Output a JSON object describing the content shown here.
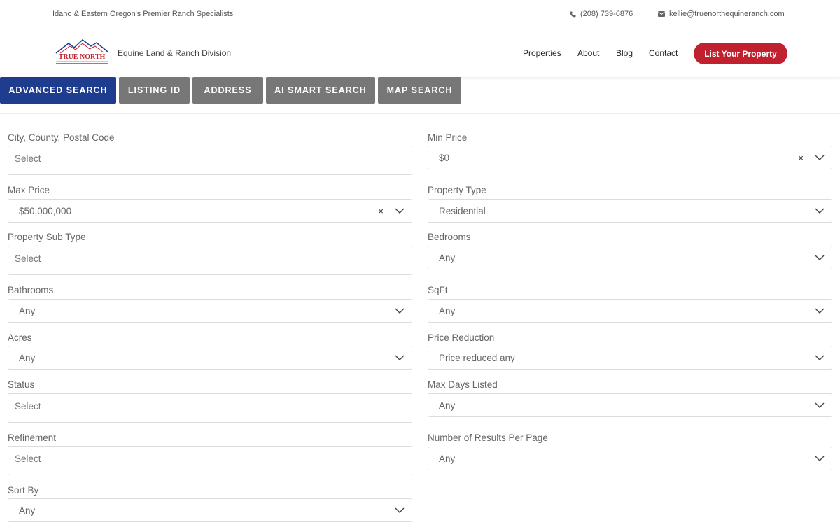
{
  "topbar": {
    "tagline": "Idaho & Eastern Oregon's Premier Ranch Specialists",
    "phone": "(208) 739-6876",
    "email": "kellie@truenorthequineranch.com"
  },
  "header": {
    "logo_title": "TRUE NORTH",
    "division": "Equine Land & Ranch Division",
    "nav": [
      "Properties",
      "About",
      "Blog",
      "Contact"
    ],
    "cta": "List Your Property",
    "accent": "#c1202e"
  },
  "tabs": [
    {
      "label": "ADVANCED SEARCH",
      "active": true
    },
    {
      "label": "LISTING ID",
      "active": false
    },
    {
      "label": "ADDRESS",
      "active": false
    },
    {
      "label": "AI SMART SEARCH",
      "active": false
    },
    {
      "label": "MAP SEARCH",
      "active": false
    }
  ],
  "form": {
    "city": {
      "label": "City, County, Postal Code",
      "value": "Select"
    },
    "min_price": {
      "label": "Min Price",
      "value": "$0"
    },
    "max_price": {
      "label": "Max Price",
      "value": "$50,000,000"
    },
    "property_type": {
      "label": "Property Type",
      "value": "Residential"
    },
    "property_sub_type": {
      "label": "Property Sub Type",
      "value": "Select"
    },
    "bedrooms": {
      "label": "Bedrooms",
      "value": "Any"
    },
    "bathrooms": {
      "label": "Bathrooms",
      "value": "Any"
    },
    "sqft": {
      "label": "SqFt",
      "value": "Any"
    },
    "acres": {
      "label": "Acres",
      "value": "Any"
    },
    "price_reduction": {
      "label": "Price Reduction",
      "value": "Price reduced any"
    },
    "status": {
      "label": "Status",
      "value": "Select"
    },
    "max_days_listed": {
      "label": "Max Days Listed",
      "value": "Any"
    },
    "refinement": {
      "label": "Refinement",
      "value": "Select"
    },
    "results_per_page": {
      "label": "Number of Results Per Page",
      "value": "Any"
    },
    "sort_by": {
      "label": "Sort By",
      "value": "Any"
    },
    "clear_symbol": "×"
  },
  "icons": [
    "phone-icon",
    "mail-icon",
    "chevron-down-icon",
    "clear-icon"
  ]
}
